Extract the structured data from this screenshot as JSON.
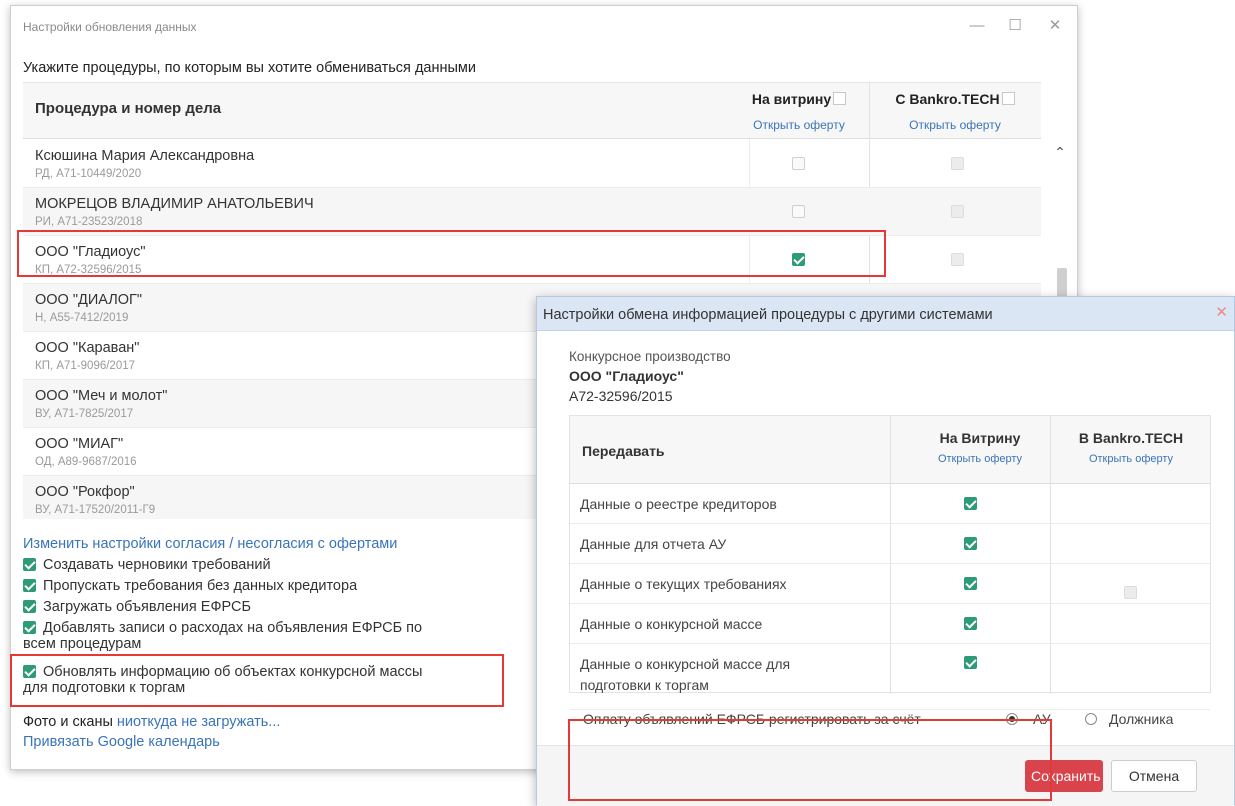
{
  "window1": {
    "title": "Настройки обновления данных",
    "minimize_glyph": "—",
    "maximize_glyph": "☐",
    "close_glyph": "✕",
    "prompt": "Укажите процедуры, по которым вы хотите обмениваться данными",
    "table": {
      "col_procedure": "Процедура и номер дела",
      "col_showcase": "На витрину",
      "col_showcase_link": "Открыть оферту",
      "col_bankro": "С Bankro.TECH",
      "col_bankro_link": "Открыть оферту",
      "rows": [
        {
          "name": "Ксюшина Мария Александровна",
          "case": "РД, А71-10449/2020",
          "showcase": false,
          "bankro": false
        },
        {
          "name": "МОКРЕЦОВ ВЛАДИМИР АНАТОЛЬЕВИЧ",
          "case": "РИ, А71-23523/2018",
          "showcase": false,
          "bankro": false
        },
        {
          "name": "ООО \"Гладиоус\"",
          "case": "КП, А72-32596/2015",
          "showcase": true,
          "bankro": false
        },
        {
          "name": "ООО \"ДИАЛОГ\"",
          "case": "Н, А55-7412/2019",
          "showcase": false,
          "bankro": false
        },
        {
          "name": "ООО \"Караван\"",
          "case": "КП, А71-9096/2017",
          "showcase": false,
          "bankro": false
        },
        {
          "name": "ООО \"Меч и молот\"",
          "case": "ВУ, А71-7825/2017",
          "showcase": false,
          "bankro": false
        },
        {
          "name": "ООО \"МИАГ\"",
          "case": "ОД, А89-9687/2016",
          "showcase": false,
          "bankro": false
        },
        {
          "name": "ООО \"Рокфор\"",
          "case": "ВУ, А71-17520/2011-Г9",
          "showcase": false,
          "bankro": false
        }
      ]
    },
    "settings": {
      "change_link": "Изменить настройки согласия / несогласия с офертами",
      "options": [
        {
          "label": "Создавать черновики требований",
          "checked": true
        },
        {
          "label": "Пропускать требования без данных кредитора",
          "checked": true
        },
        {
          "label": "Загружать объявления ЕФРСБ",
          "checked": true
        },
        {
          "label": "Добавлять записи о расходах на объявления ЕФРСБ по",
          "label2": "всем процедурам",
          "checked": true
        },
        {
          "label": "Обновлять информацию об объектах конкурсной массы",
          "label2": "для подготовки к торгам",
          "checked": true
        }
      ],
      "photo_label": "Фото и сканы ",
      "photo_link": "ниоткуда не загружать...",
      "google_link": "Привязать Google календарь"
    }
  },
  "window2": {
    "title": "Настройки обмена информацией процедуры с другими системами",
    "close_glyph": "✕",
    "procedure_type": "Конкурсное производство",
    "org": "ООО \"Гладиоус\"",
    "case": "А72-32596/2015",
    "table": {
      "col_transfer": "Передавать",
      "col_showcase": "На Витрину",
      "col_showcase_link": "Открыть оферту",
      "col_bankro": "В Bankro.TECH",
      "col_bankro_link": "Открыть оферту",
      "rows": [
        {
          "label": "Данные о реестре кредиторов",
          "checked": true
        },
        {
          "label": "Данные для отчета АУ",
          "checked": true
        },
        {
          "label": "Данные о текущих требованиях",
          "checked": true
        },
        {
          "label": "Данные о конкурсной массе",
          "checked": true
        },
        {
          "label": "Данные о конкурсной массе для",
          "label2": "подготовки к торгам",
          "checked": true
        }
      ]
    },
    "payment_label": "Оплату объявлений ЕФРСБ регистрировать за счёт",
    "payment_options": [
      {
        "label": "АУ",
        "selected": true
      },
      {
        "label": "Должника",
        "selected": false
      }
    ],
    "save_label": "Сохранить",
    "cancel_label": "Отмена"
  },
  "colors": {
    "accent_link": "#3a74b8",
    "checkbox_checked": "#2e9a77",
    "highlight_border": "#e53935",
    "save_button": "#d9434b",
    "dialog_titlebar": "#dbe6f4"
  },
  "icons": [
    "minimize-icon",
    "maximize-icon",
    "close-icon",
    "chevron-up-icon",
    "checkbox-checked-icon",
    "checkbox-empty-icon",
    "radio-icon"
  ]
}
